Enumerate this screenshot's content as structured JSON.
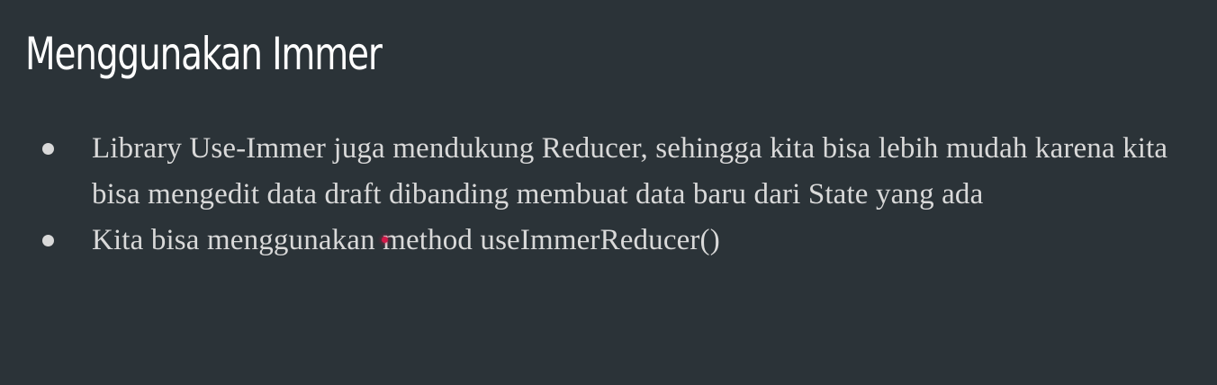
{
  "slide": {
    "title": "Menggunakan Immer",
    "bullets": [
      {
        "text": "Library Use-Immer juga mendukung Reducer, sehingga kita bisa lebih mudah karena kita bisa mengedit data draft dibanding membuat data baru dari State yang ada"
      },
      {
        "text": "Kita bisa menggunakan method useImmerReducer()"
      }
    ]
  },
  "colors": {
    "background": "#2b3338",
    "title": "#ffffff",
    "body_text": "#d9d9d9",
    "laser_pointer": "#d21a4a"
  }
}
